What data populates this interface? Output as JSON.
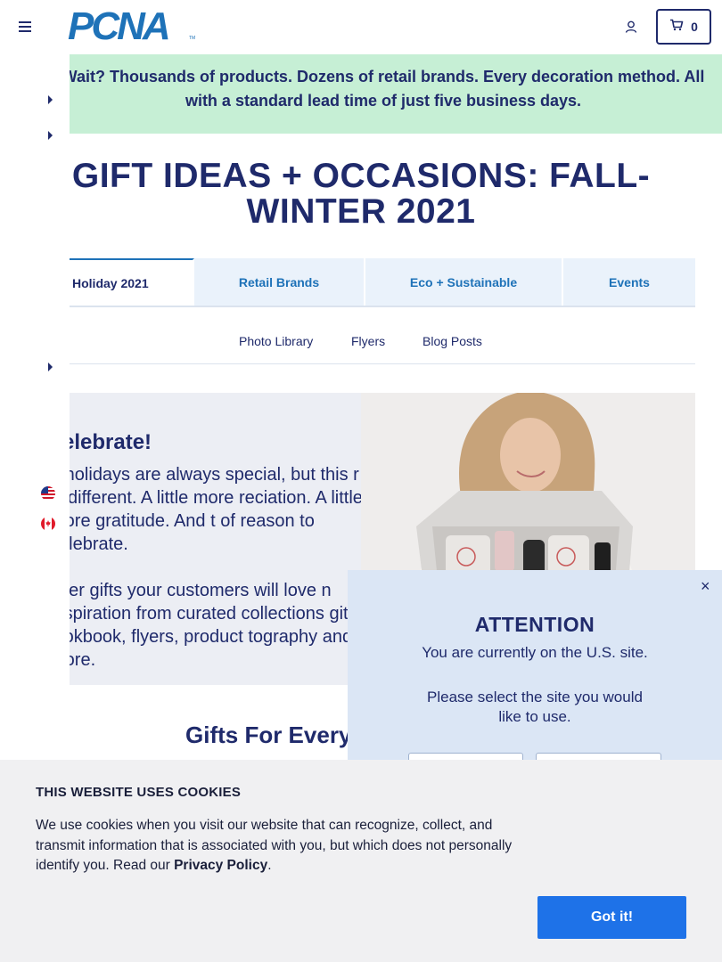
{
  "header": {
    "logo_text": "PCNA",
    "logo_tm": "TM",
    "cart_count": "0"
  },
  "banner": {
    "text": "Wait? Thousands of products. Dozens of retail brands. Every decoration method. All with a standard lead time of just five business days."
  },
  "page": {
    "title": "GIFT IDEAS + OCCASIONS: FALL-WINTER 2021"
  },
  "tabs": [
    {
      "label": "Holiday 2021",
      "active": true
    },
    {
      "label": "Retail Brands",
      "active": false
    },
    {
      "label": "Eco + Sustainable",
      "active": false
    },
    {
      "label": "Events",
      "active": false
    }
  ],
  "subnav": {
    "photo_library": "Photo Library",
    "flyers": "Flyers",
    "blog_posts": "Blog Posts"
  },
  "celebrate": {
    "title": "elebrate!",
    "paragraph1": "e holidays are always special, but this r is different. A little more reciation. A little more gratitude. And t of reason to celebrate.",
    "paragraph2": "ever gifts your customers will love n inspiration from curated collections gital lookbook, flyers, product tography and more."
  },
  "section": {
    "heading": "Gifts For Every"
  },
  "modal": {
    "close": "×",
    "title": "ATTENTION",
    "line1": "You are currently on the U.S. site.",
    "line2": "Please select the site you would like to use."
  },
  "cookie": {
    "title": "THIS WEBSITE USES COOKIES",
    "text": "We use cookies when you visit our website that can recognize, collect, and transmit information that is associated with you, but which does not personally identify you. Read our ",
    "link": "Privacy Policy",
    "end": ".",
    "button": "Got it!"
  },
  "colors": {
    "navy": "#1f2a6b",
    "brand_blue": "#1e72b8",
    "banner_green": "#c6efd5",
    "cookie_button": "#1e72e8"
  }
}
